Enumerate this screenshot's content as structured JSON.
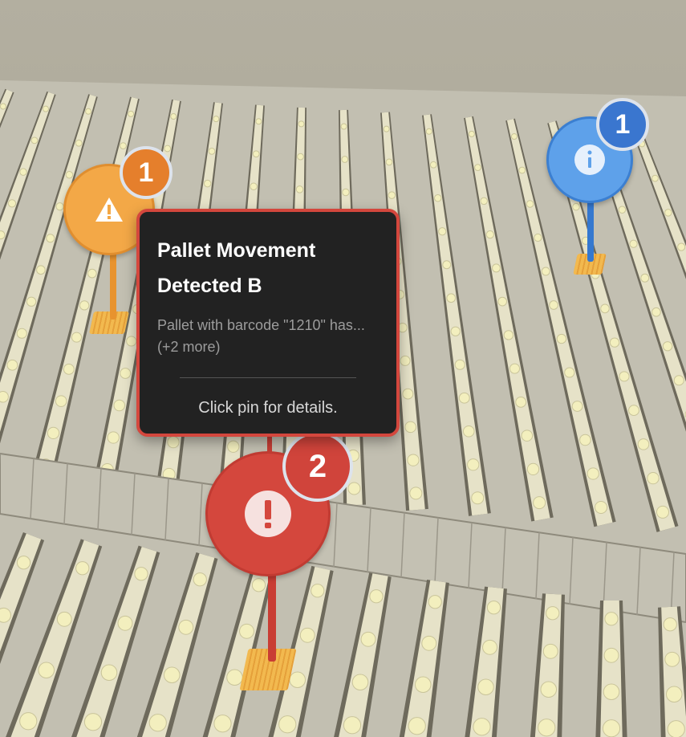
{
  "pins": {
    "warning": {
      "severity": "warning",
      "icon": "warning-triangle-icon",
      "count": "1",
      "color": "#f3a847",
      "badge_color": "#e57f2c"
    },
    "info": {
      "severity": "info",
      "icon": "info-icon",
      "count": "1",
      "color": "#5ea1ea",
      "badge_color": "#3a76cf"
    },
    "critical": {
      "severity": "critical",
      "icon": "exclamation-icon",
      "count": "2",
      "color": "#d4473d",
      "badge_color": "#d0443b"
    }
  },
  "tooltip": {
    "title": "Pallet Movement Detected B",
    "description": "Pallet with barcode \"1210\" has... (+2 more)",
    "hint": "Click pin for details.",
    "border_color": "#d4473d"
  },
  "scene": {
    "floor_color": "#bdb9ab",
    "rack_color": "#e6e2c8",
    "pallet_color": "#f3efbe"
  }
}
